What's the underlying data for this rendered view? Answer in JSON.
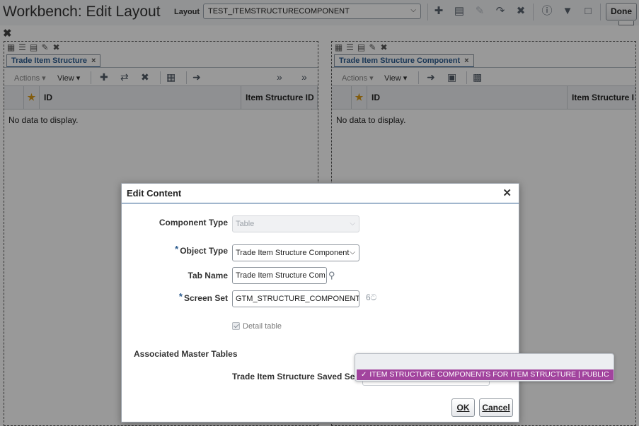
{
  "header": {
    "title": "Workbench: Edit Layout",
    "layout_label": "Layout",
    "layout_value": "TEST_ITEMSTRUCTURECOMPONENT",
    "done_label": "Done",
    "icons": [
      "plus-icon",
      "page-icon",
      "pencil-icon",
      "redo-icon",
      "close-icon",
      "info-icon",
      "filter-icon",
      "monitor-icon"
    ]
  },
  "panels": [
    {
      "tab_label": "Trade Item Structure",
      "actions_label": "Actions",
      "view_label": "View",
      "columns": [
        "ID",
        "Item Structure ID"
      ],
      "no_data": "No data to display."
    },
    {
      "tab_label": "Trade Item Structure Component",
      "actions_label": "Actions",
      "view_label": "View",
      "columns": [
        "ID",
        "Item Structure I"
      ],
      "no_data": "No data to display."
    }
  ],
  "dialog": {
    "title": "Edit Content",
    "component_type_label": "Component Type",
    "component_type_value": "Table",
    "object_type_label": "Object Type",
    "object_type_value": "Trade Item Structure Component",
    "tab_name_label": "Tab Name",
    "tab_name_value": "Trade Item Structure Com",
    "screen_set_label": "Screen Set",
    "screen_set_value": "GTM_STRUCTURE_COMPONENT",
    "detail_table_label": "Detail table",
    "associated_master_label": "Associated Master Tables",
    "saved_search_label": "Trade Item Structure Saved Search",
    "ok_label": "OK",
    "cancel_label": "Cancel"
  },
  "dropdown": {
    "selected_option": "ITEM STRUCTURE COMPONENTS FOR ITEM STRUCTURE | PUBLIC"
  },
  "colors": {
    "accent": "#2c5c8f",
    "selection": "#a2449e",
    "star": "#d99a16"
  }
}
